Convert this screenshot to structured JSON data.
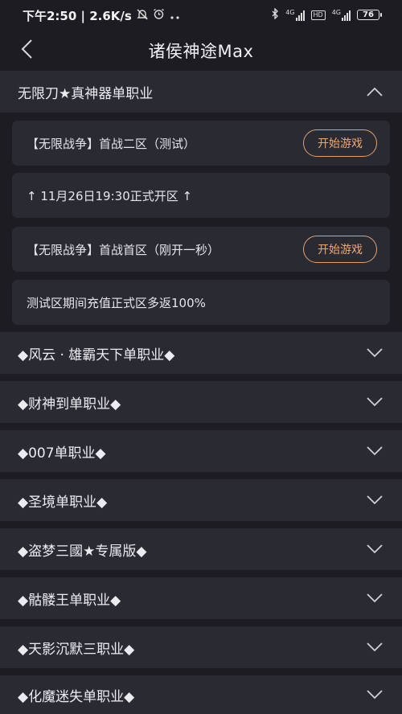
{
  "status_bar": {
    "time_speed": "下午2:50 | 2.6K/s",
    "network_1": "4G",
    "hd": "HD",
    "network_2": "4G",
    "battery": "76"
  },
  "nav": {
    "title": "诸侯神途Max"
  },
  "expanded_section": {
    "title": "无限刀★真神器单职业",
    "cards": [
      {
        "text": "【无限战争】首战二区（测试）",
        "button": "开始游戏"
      },
      {
        "text": "↑ 11月26日19:30正式开区 ↑"
      },
      {
        "text": "【无限战争】首战首区（刚开一秒）",
        "button": "开始游戏"
      },
      {
        "text": "测试区期间充值正式区多返100%"
      }
    ]
  },
  "collapsed_sections": [
    {
      "title": "◆风云 · 雄霸天下单职业◆"
    },
    {
      "title": "◆财神到单职业◆"
    },
    {
      "title": "◆007单职业◆"
    },
    {
      "title": "◆圣境单职业◆"
    },
    {
      "title": "◆盗梦三國★专属版◆"
    },
    {
      "title": "◆骷髅王单职业◆"
    },
    {
      "title": "◆天影沉默三职业◆"
    },
    {
      "title": "◆化魔迷失单职业◆"
    }
  ],
  "colors": {
    "background": "#1d1c23",
    "panel": "#2a2a33",
    "accent_orange": "#f0a86d"
  }
}
